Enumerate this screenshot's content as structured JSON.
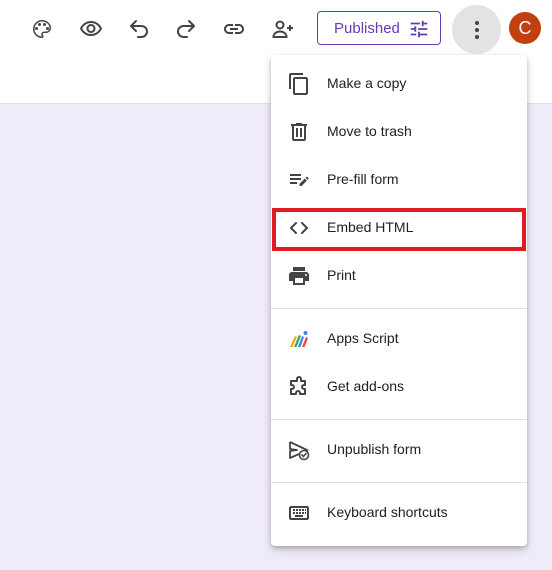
{
  "toolbar": {
    "icons": [
      "palette-icon",
      "preview-icon",
      "undo-icon",
      "redo-icon",
      "link-icon",
      "add-collaborator-icon"
    ],
    "published_label": "Published",
    "avatar_letter": "C"
  },
  "menu": {
    "items": [
      {
        "label": "Make a copy",
        "icon": "copy-icon"
      },
      {
        "label": "Move to trash",
        "icon": "trash-icon"
      },
      {
        "label": "Pre-fill form",
        "icon": "prefill-icon"
      },
      {
        "label": "Embed HTML",
        "icon": "code-icon"
      },
      {
        "label": "Print",
        "icon": "print-icon"
      },
      {
        "label": "Apps Script",
        "icon": "apps-script-icon"
      },
      {
        "label": "Get add-ons",
        "icon": "addons-icon"
      },
      {
        "label": "Unpublish form",
        "icon": "unpublish-icon"
      },
      {
        "label": "Keyboard shortcuts",
        "icon": "keyboard-icon"
      }
    ]
  },
  "colors": {
    "accent": "#673ab7",
    "highlight": "#e01b24",
    "avatar": "#c0400f",
    "background": "#f0ebf8"
  }
}
